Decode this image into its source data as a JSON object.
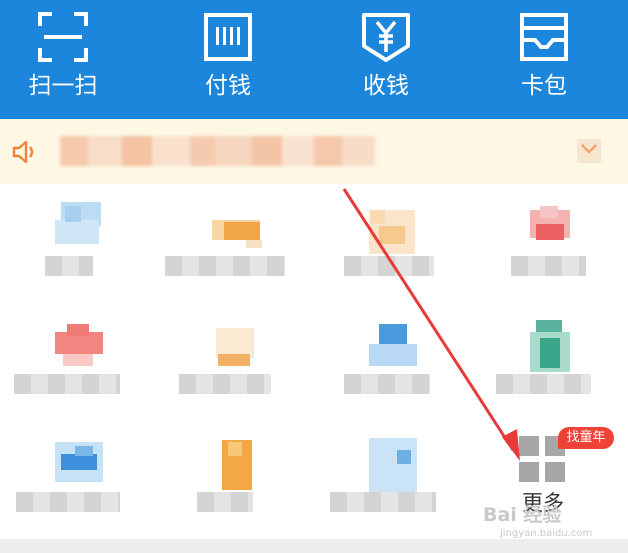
{
  "top_actions": [
    {
      "label": "扫一扫",
      "icon": "scan-icon"
    },
    {
      "label": "付钱",
      "icon": "pay-code-icon"
    },
    {
      "label": "收钱",
      "icon": "collect-money-icon"
    },
    {
      "label": "卡包",
      "icon": "card-wallet-icon"
    }
  ],
  "colors": {
    "brand_blue": "#1c86dc",
    "notice_bg": "#fdf7e4",
    "accent_orange": "#f2833a",
    "badge_red": "#ee4236",
    "arrow_red": "#e83a3a"
  },
  "more": {
    "label": "更多",
    "icon": "more-grid-icon",
    "badge": "找童年"
  },
  "watermark": {
    "brand": "Bai 经验",
    "url": "jingyan.baidu.com"
  }
}
